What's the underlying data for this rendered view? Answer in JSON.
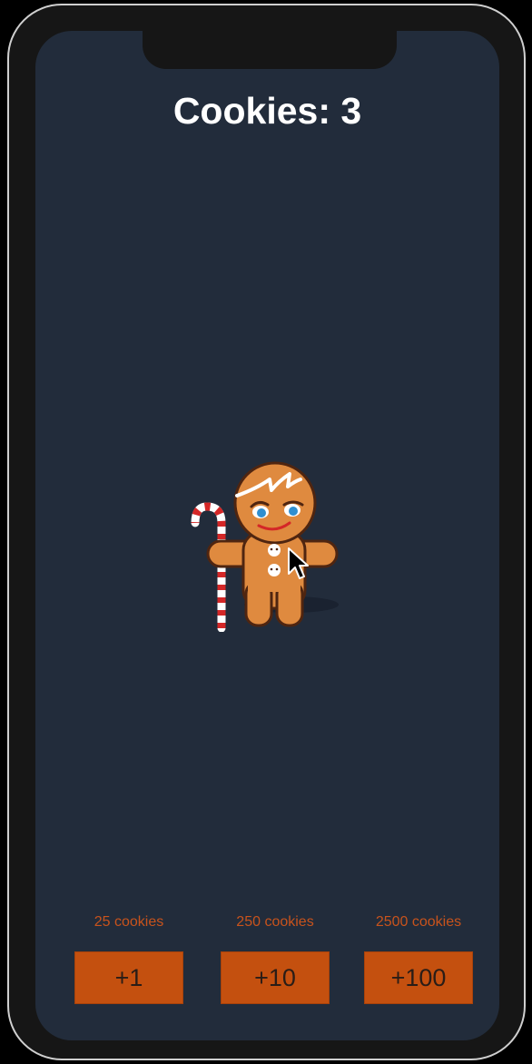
{
  "score": {
    "text": "Cookies: 3"
  },
  "character": {
    "icon": "gingerbread-man-icon",
    "colors": {
      "body": "#df8a3f",
      "outline": "#4f2510",
      "eyes": "#2f8fd0",
      "cane_red": "#d42727"
    }
  },
  "upgrades": [
    {
      "cost_label": "25 cookies",
      "button_label": "+1"
    },
    {
      "cost_label": "250 cookies",
      "button_label": "+10"
    },
    {
      "cost_label": "2500 cookies",
      "button_label": "+100"
    }
  ],
  "colors": {
    "background": "#222c3b",
    "accent": "#c4500f",
    "cost_text": "#c8531c",
    "score_text": "#ffffff"
  }
}
